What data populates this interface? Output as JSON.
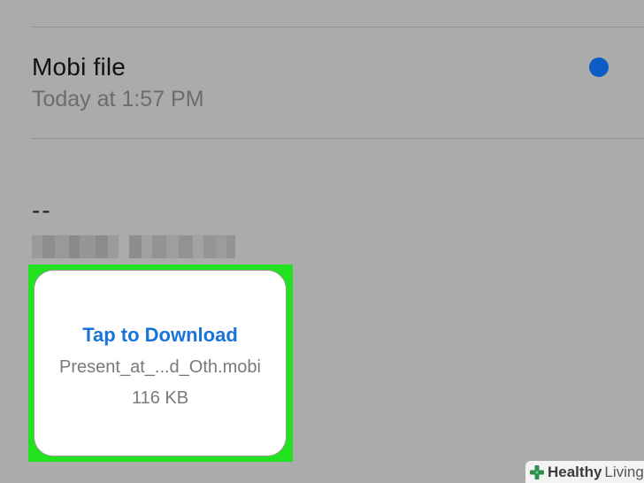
{
  "message": {
    "subject": "Mobi file",
    "timestamp": "Today at 1:57 PM",
    "unread_color": "#0d5bc4",
    "signature_separator": "--"
  },
  "attachment": {
    "action_label": "Tap to Download",
    "file_name": "Present_at_...d_Oth.mobi",
    "file_size": "116 KB",
    "highlight_color": "#22e11e",
    "action_color": "#1a73d9"
  },
  "watermark": {
    "icon": "plus-cross-icon",
    "brand_strong": "Healthy",
    "brand_light": "Living"
  }
}
